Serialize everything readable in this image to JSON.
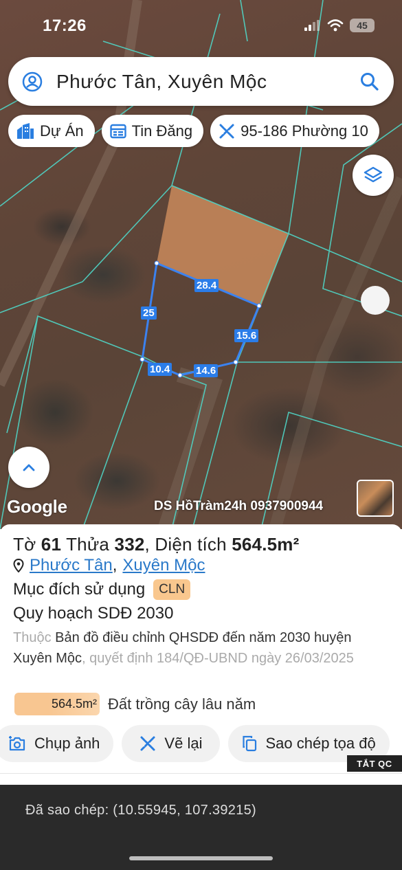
{
  "status_bar": {
    "time": "17:26",
    "battery": "45"
  },
  "search": {
    "text": "Phước Tân, Xuyên Mộc"
  },
  "chips": [
    {
      "label": "Dự Án",
      "icon": "city-icon"
    },
    {
      "label": "Tin Đăng",
      "icon": "listing-icon"
    },
    {
      "label": "95-186 Phường 10",
      "icon": "ruler-icon"
    }
  ],
  "map": {
    "attribution": "Google",
    "watermark": "DS HồTràm24h 0937900944",
    "dimensions": [
      "28.4",
      "25",
      "15.6",
      "10.4",
      "14.6"
    ],
    "accent_color": "#2b7de9",
    "parcel_line_color": "#4fd6c7"
  },
  "parcel": {
    "to_label": "Tờ",
    "to_value": "61",
    "thua_label": "Thửa",
    "thua_value": "332",
    "area_label": "Diện tích",
    "area_value": "564.5m²",
    "ward": "Phước Tân",
    "district": "Xuyên Mộc",
    "purpose_label": "Mục đích sử dụng",
    "purpose_code": "CLN",
    "plan_title": "Quy hoạch SDĐ 2030",
    "desc_prefix": "Thuộc",
    "desc_map": "Bản đồ điều chỉnh QHSDĐ đến năm 2030 huyện Xuyên Mộc",
    "desc_decision": ", quyết định 184/QĐ-UBND ngày 26/03/2025",
    "area_badge": "564.5m²",
    "land_type": "Đất trồng cây lâu năm"
  },
  "actions": [
    {
      "label": "Chụp ảnh",
      "icon": "camera-icon"
    },
    {
      "label": "Vẽ lại",
      "icon": "redraw-icon"
    },
    {
      "label": "Sao chép tọa độ",
      "icon": "copy-icon"
    }
  ],
  "ad_toggle": "TẮT QC",
  "toast": {
    "text": "Đã sao chép: (10.55945, 107.39215)"
  }
}
